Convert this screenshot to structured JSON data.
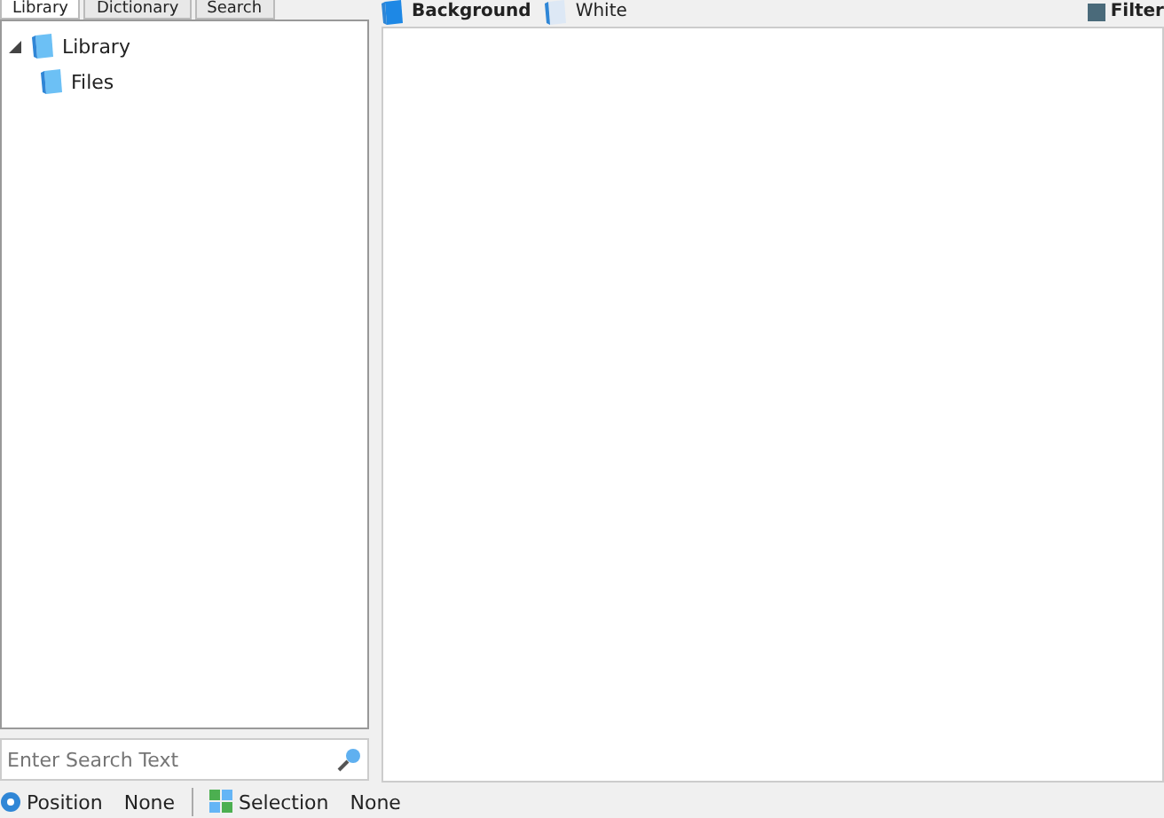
{
  "left_tabs": [
    {
      "label": "Library",
      "selected": true
    },
    {
      "label": "Dictionary",
      "selected": false
    },
    {
      "label": "Search",
      "selected": false
    }
  ],
  "tree": [
    {
      "label": "Library",
      "expanded": true,
      "children": [
        {
          "label": "Files"
        }
      ]
    }
  ],
  "search": {
    "placeholder": "Enter Search Text"
  },
  "toolbar": {
    "background_label": "Background",
    "color_label": "White",
    "filter_label": "Filter"
  },
  "status_bar": [
    {
      "kind": "position",
      "label": "Position",
      "value": "None"
    },
    {
      "kind": "selection",
      "label": "Selection",
      "value": "None"
    }
  ]
}
